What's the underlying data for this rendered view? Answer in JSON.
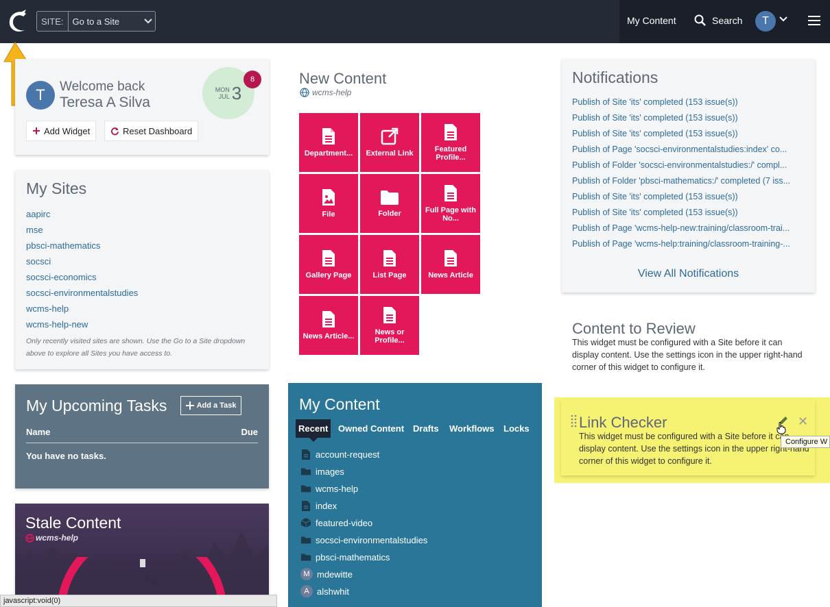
{
  "topbar": {
    "site_label": "SITE:",
    "site_value": "Go to a Site",
    "my_content": "My Content",
    "search": "Search",
    "avatar_initial": "T"
  },
  "welcome": {
    "avatar_initial": "T",
    "greeting": "Welcome back",
    "name": "Teresa A Silva",
    "date_weekday": "MON",
    "date_month": "JUL",
    "date_day": "3",
    "badge_count": "8",
    "add_widget": "Add Widget",
    "reset_dashboard": "Reset Dashboard"
  },
  "my_sites": {
    "title": "My Sites",
    "items": [
      "aapirc",
      "mse",
      "pbsci-mathematics",
      "socsci",
      "socsci-economics",
      "socsci-environmentalstudies",
      "wcms-help",
      "wcms-help-new"
    ],
    "note": "Only recently visited sites are shown. Use the Go to a Site dropdown above to explore all Sites you have access to."
  },
  "tasks": {
    "title": "My Upcoming Tasks",
    "add_task": "Add a Task",
    "col_name": "Name",
    "col_due": "Due",
    "empty": "You have no tasks."
  },
  "stale": {
    "title": "Stale Content",
    "site": "wcms-help"
  },
  "statusbar": "javascript:void(0)",
  "new_content": {
    "title": "New Content",
    "site": "wcms-help",
    "tiles": [
      {
        "label": "Department...",
        "icon": "document-icon"
      },
      {
        "label": "External Link",
        "icon": "external-link-icon"
      },
      {
        "label": "Featured Profile...",
        "icon": "document-icon"
      },
      {
        "label": "File",
        "icon": "image-file-icon"
      },
      {
        "label": "Folder",
        "icon": "folder-icon"
      },
      {
        "label": "Full Page with No...",
        "icon": "document-icon"
      },
      {
        "label": "Gallery Page",
        "icon": "document-icon"
      },
      {
        "label": "List Page",
        "icon": "document-icon"
      },
      {
        "label": "News Article",
        "icon": "document-icon"
      },
      {
        "label": "News Article...",
        "icon": "document-icon"
      },
      {
        "label": "News or Profile...",
        "icon": "document-icon"
      }
    ]
  },
  "my_content": {
    "title": "My Content",
    "tabs": [
      "Recent",
      "Owned Content",
      "Drafts",
      "Workflows",
      "Locks"
    ],
    "active_tab": "Recent",
    "items": [
      {
        "label": "account-request",
        "icon": "document-icon"
      },
      {
        "label": "images",
        "icon": "folder-icon"
      },
      {
        "label": "wcms-help",
        "icon": "folder-icon"
      },
      {
        "label": "index",
        "icon": "document-icon"
      },
      {
        "label": "featured-video",
        "icon": "block-icon"
      },
      {
        "label": "socsci-environmentalstudies",
        "icon": "folder-icon"
      },
      {
        "label": "pbsci-mathematics",
        "icon": "folder-icon"
      },
      {
        "label": "mdewitte",
        "icon": "user-avatar",
        "initial": "M"
      },
      {
        "label": "alshwhit",
        "icon": "user-avatar",
        "initial": "A"
      }
    ]
  },
  "notifications": {
    "title": "Notifications",
    "items": [
      "Publish of Site 'its' completed (153 issue(s))",
      "Publish of Site 'its' completed (153 issue(s))",
      "Publish of Site 'its' completed (153 issue(s))",
      "Publish of Page 'socsci-environmentalstudies:index' co...",
      "Publish of Folder 'socsci-environmentalstudies:/' compl...",
      "Publish of Folder 'pbsci-mathematics:/' completed (7 iss...",
      "Publish of Site 'its' completed (153 issue(s))",
      "Publish of Site 'its' completed (153 issue(s))",
      "Publish of Page 'wcms-help-new:training/classroom-trai...",
      "Publish of Page 'wcms-help:training/classroom-training-..."
    ],
    "view_all": "View All Notifications"
  },
  "content_review": {
    "title": "Content to Review",
    "body": "This widget must be configured with a Site before it can display content. Use the settings icon in the upper right-hand corner of this widget to configure it."
  },
  "link_checker": {
    "title": "Link Checker",
    "body": "This widget must be configured with a Site before it can display content. Use the settings icon in the upper right-hand corner of this widget to configure it.",
    "tooltip": "Configure W"
  },
  "colors": {
    "topbar": "#252a37",
    "tile": "#e2185a",
    "my_content": "#2a7698",
    "tasks": "#5e7383",
    "link": "#2d6b9a",
    "highlight": "#f6f273"
  }
}
